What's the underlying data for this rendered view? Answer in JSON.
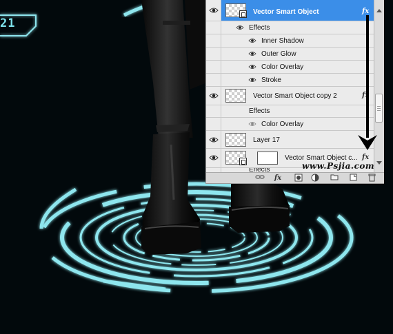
{
  "badge": {
    "text": "21"
  },
  "layers_panel": {
    "layers": [
      {
        "name": "Vector Smart Object",
        "selected": true,
        "has_fx": true,
        "fx_label": "fx"
      },
      {
        "name": "Vector Smart Object copy 2",
        "selected": false,
        "has_fx": true,
        "fx_label": "fx"
      },
      {
        "name": "Layer 17",
        "selected": false,
        "has_fx": false
      },
      {
        "name": "Vector Smart Object c...",
        "selected": false,
        "has_fx": true,
        "fx_label": "fx"
      }
    ],
    "layer1_effects": {
      "header": "Effects",
      "items": [
        "Inner Shadow",
        "Outer Glow",
        "Color Overlay",
        "Stroke"
      ]
    },
    "layer2_effects": {
      "header": "Effects",
      "items": [
        "Color Overlay"
      ]
    },
    "partial_effects_label": "Effects",
    "footer": {
      "fx_label": "fx"
    }
  },
  "watermark": "www.Psjia.com",
  "colors": {
    "background": "#02090c",
    "ring_cyan": "#8ee6ee",
    "selection_blue": "#3b8ee8",
    "panel_gray": "#ebebeb"
  },
  "icons": [
    "eye-icon",
    "link-icon",
    "fx-icon",
    "mask-icon",
    "adjustment-icon",
    "folder-icon",
    "new-layer-icon",
    "trash-icon",
    "scroll-up-icon",
    "scroll-down-icon",
    "smart-object-icon"
  ]
}
